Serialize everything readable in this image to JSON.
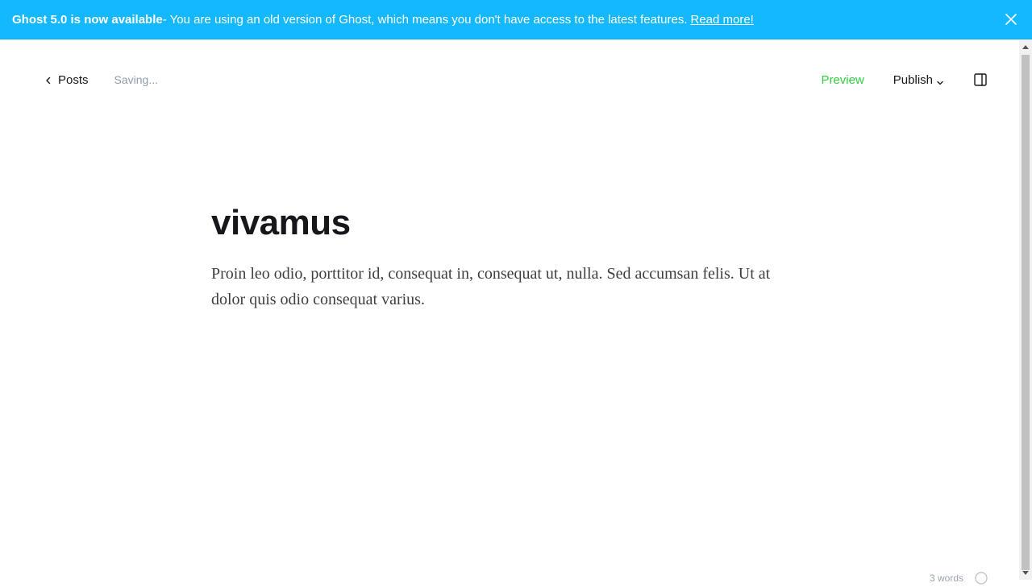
{
  "banner": {
    "headline": "Ghost 5.0 is now available",
    "message": " - You are using an old version of Ghost, which means you don't have access to the latest features.",
    "link": "Read more!",
    "close_icon": "close-icon",
    "background": "#14b8ff"
  },
  "toolbar": {
    "back_label": "Posts",
    "back_icon": "chevron-left-icon",
    "status": "Saving...",
    "preview_label": "Preview",
    "publish_label": "Publish",
    "publish_icon": "chevron-down-icon",
    "sidebar_icon": "sidebar-toggle-icon",
    "accent": "#30cf43"
  },
  "post": {
    "title": "vivamus",
    "body": "Proin leo odio, porttitor id, consequat in, consequat ut, nulla. Sed accumsan felis. Ut at dolor quis odio consequat varius."
  },
  "footer": {
    "word_count": "3 words",
    "help_icon": "help-icon"
  }
}
